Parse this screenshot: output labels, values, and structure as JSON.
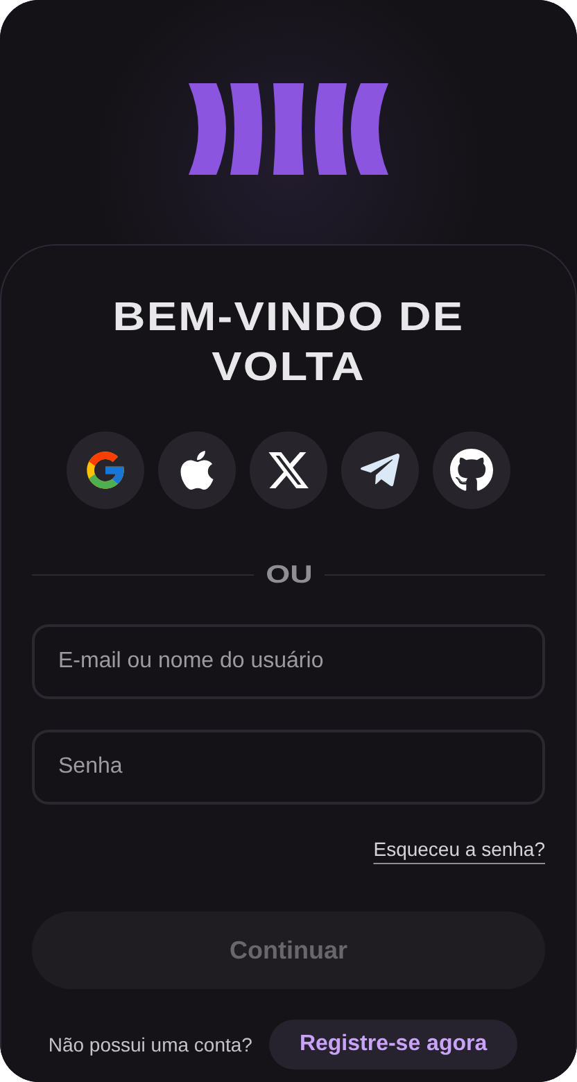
{
  "title": "BEM-VINDO DE VOLTA",
  "social_buttons": [
    {
      "kind": "google"
    },
    {
      "kind": "apple"
    },
    {
      "kind": "x"
    },
    {
      "kind": "telegram"
    },
    {
      "kind": "github"
    }
  ],
  "divider_text": "OU",
  "fields": [
    {
      "placeholder": "E-mail ou nome do usuário"
    },
    {
      "placeholder": "Senha"
    }
  ],
  "forgot_link": "Esqueceu a senha?",
  "continue_button": {
    "label": "Continuar",
    "disabled": true
  },
  "signup_prompt": "Não possui uma conta?",
  "signup_link": "Registre-se agora"
}
